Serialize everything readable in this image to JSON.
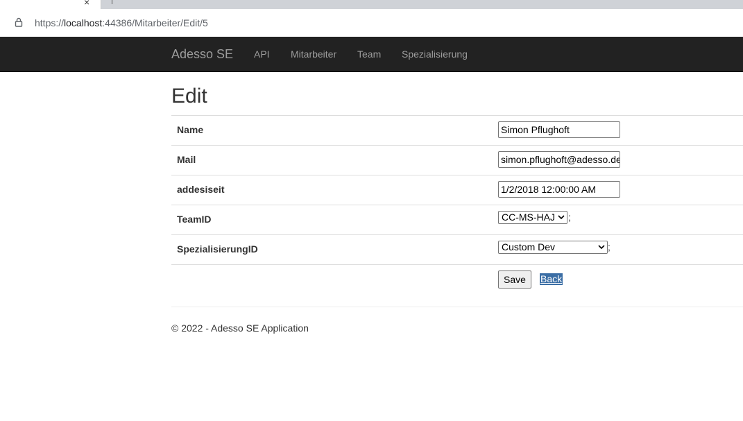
{
  "browser": {
    "tab_close_glyph": "×",
    "url_prefix": "https://",
    "url_host": "localhost",
    "url_rest": ":44386/Mitarbeiter/Edit/5"
  },
  "navbar": {
    "brand": "Adesso SE",
    "items": [
      "API",
      "Mitarbeiter",
      "Team",
      "Spezialisierung"
    ]
  },
  "page": {
    "title": "Edit"
  },
  "form": {
    "name_label": "Name",
    "name_value": "Simon Pflughoft",
    "mail_label": "Mail",
    "mail_value": "simon.pflughoft@adesso.de",
    "addesiseit_label": "addesiseit",
    "addesiseit_value": "1/2/2018 12:00:00 AM",
    "teamid_label": "TeamID",
    "teamid_value": "CC-MS-HAJ",
    "spez_label": "SpezialisierungID",
    "spez_value": "Custom Dev",
    "semicolon": ";",
    "save_label": "Save",
    "back_label": "Back"
  },
  "footer": {
    "text": "© 2022 - Adesso SE Application"
  },
  "colors": {
    "navbar_bg": "#222222",
    "nav_text": "#9d9d9d",
    "back_highlight": "#3b6ea5"
  }
}
